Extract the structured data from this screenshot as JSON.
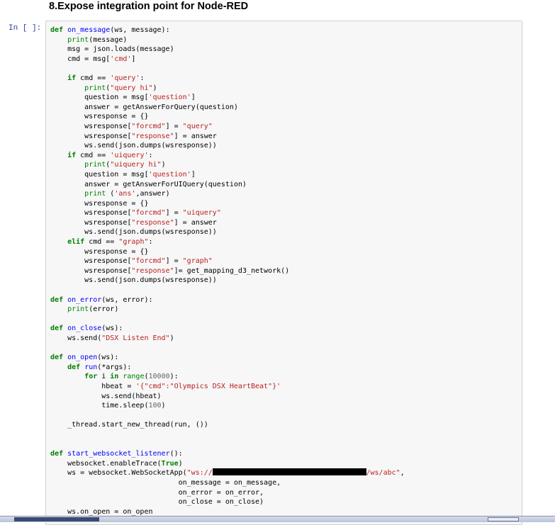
{
  "heading": "8.Expose integration point for Node-RED",
  "cell": {
    "prompt": "In [ ]:",
    "lines": [
      [
        [
          "kw",
          "def "
        ],
        [
          "fn",
          "on_message"
        ],
        [
          "t",
          "(ws, message):"
        ]
      ],
      [
        [
          "t",
          "    "
        ],
        [
          "bi",
          "print"
        ],
        [
          "t",
          "(message)"
        ]
      ],
      [
        [
          "t",
          "    msg = json.loads(message)"
        ]
      ],
      [
        [
          "t",
          "    cmd = msg["
        ],
        [
          "str",
          "'cmd'"
        ],
        [
          "t",
          "]"
        ]
      ],
      [
        [
          "t",
          ""
        ]
      ],
      [
        [
          "t",
          "    "
        ],
        [
          "kw",
          "if"
        ],
        [
          "t",
          " cmd == "
        ],
        [
          "str",
          "'query'"
        ],
        [
          "t",
          ":"
        ]
      ],
      [
        [
          "t",
          "        "
        ],
        [
          "bi",
          "print"
        ],
        [
          "t",
          "("
        ],
        [
          "str",
          "\"query hi\""
        ],
        [
          "t",
          ")"
        ]
      ],
      [
        [
          "t",
          "        question = msg["
        ],
        [
          "str",
          "'question'"
        ],
        [
          "t",
          "]"
        ]
      ],
      [
        [
          "t",
          "        answer = getAnswerForQuery(question)"
        ]
      ],
      [
        [
          "t",
          "        wsresponse = {}"
        ]
      ],
      [
        [
          "t",
          "        wsresponse["
        ],
        [
          "str",
          "\"forcmd\""
        ],
        [
          "t",
          "] = "
        ],
        [
          "str",
          "\"query\""
        ]
      ],
      [
        [
          "t",
          "        wsresponse["
        ],
        [
          "str",
          "\"response\""
        ],
        [
          "t",
          "] = answer"
        ]
      ],
      [
        [
          "t",
          "        ws.send(json.dumps(wsresponse))"
        ]
      ],
      [
        [
          "t",
          "    "
        ],
        [
          "kw",
          "if"
        ],
        [
          "t",
          " cmd == "
        ],
        [
          "str",
          "'uiquery'"
        ],
        [
          "t",
          ":"
        ]
      ],
      [
        [
          "t",
          "        "
        ],
        [
          "bi",
          "print"
        ],
        [
          "t",
          "("
        ],
        [
          "str",
          "\"uiquery hi\""
        ],
        [
          "t",
          ")"
        ]
      ],
      [
        [
          "t",
          "        question = msg["
        ],
        [
          "str",
          "'question'"
        ],
        [
          "t",
          "]"
        ]
      ],
      [
        [
          "t",
          "        answer = getAnswerForUIQuery(question)"
        ]
      ],
      [
        [
          "t",
          "        "
        ],
        [
          "bi",
          "print"
        ],
        [
          "t",
          " ("
        ],
        [
          "str",
          "'ans'"
        ],
        [
          "t",
          ",answer)"
        ]
      ],
      [
        [
          "t",
          "        wsresponse = {}"
        ]
      ],
      [
        [
          "t",
          "        wsresponse["
        ],
        [
          "str",
          "\"forcmd\""
        ],
        [
          "t",
          "] = "
        ],
        [
          "str",
          "\"uiquery\""
        ]
      ],
      [
        [
          "t",
          "        wsresponse["
        ],
        [
          "str",
          "\"response\""
        ],
        [
          "t",
          "] = answer"
        ]
      ],
      [
        [
          "t",
          "        ws.send(json.dumps(wsresponse))"
        ]
      ],
      [
        [
          "t",
          "    "
        ],
        [
          "kw",
          "elif"
        ],
        [
          "t",
          " cmd == "
        ],
        [
          "str",
          "\"graph\""
        ],
        [
          "t",
          ":"
        ]
      ],
      [
        [
          "t",
          "        wsresponse = {}"
        ]
      ],
      [
        [
          "t",
          "        wsresponse["
        ],
        [
          "str",
          "\"forcmd\""
        ],
        [
          "t",
          "] = "
        ],
        [
          "str",
          "\"graph\""
        ]
      ],
      [
        [
          "t",
          "        wsresponse["
        ],
        [
          "str",
          "\"response\""
        ],
        [
          "t",
          "]= get_mapping_d3_network()"
        ]
      ],
      [
        [
          "t",
          "        ws.send(json.dumps(wsresponse))"
        ]
      ],
      [
        [
          "t",
          ""
        ]
      ],
      [
        [
          "kw",
          "def "
        ],
        [
          "fn",
          "on_error"
        ],
        [
          "t",
          "(ws, error):"
        ]
      ],
      [
        [
          "t",
          "    "
        ],
        [
          "bi",
          "print"
        ],
        [
          "t",
          "(error)"
        ]
      ],
      [
        [
          "t",
          ""
        ]
      ],
      [
        [
          "kw",
          "def "
        ],
        [
          "fn",
          "on_close"
        ],
        [
          "t",
          "(ws):"
        ]
      ],
      [
        [
          "t",
          "    ws.send("
        ],
        [
          "str",
          "\"DSX Listen End\""
        ],
        [
          "t",
          ")"
        ]
      ],
      [
        [
          "t",
          ""
        ]
      ],
      [
        [
          "kw",
          "def "
        ],
        [
          "fn",
          "on_open"
        ],
        [
          "t",
          "(ws):"
        ]
      ],
      [
        [
          "t",
          "    "
        ],
        [
          "kw",
          "def "
        ],
        [
          "fn",
          "run"
        ],
        [
          "t",
          "(*args):"
        ]
      ],
      [
        [
          "t",
          "        "
        ],
        [
          "kw",
          "for"
        ],
        [
          "t",
          " i "
        ],
        [
          "kw",
          "in"
        ],
        [
          "t",
          " "
        ],
        [
          "bi",
          "range"
        ],
        [
          "t",
          "("
        ],
        [
          "num",
          "10000"
        ],
        [
          "t",
          "):"
        ]
      ],
      [
        [
          "t",
          "            hbeat = "
        ],
        [
          "str",
          "'{\"cmd\":\"Olympics DSX HeartBeat\"}'"
        ]
      ],
      [
        [
          "t",
          "            ws.send(hbeat)"
        ]
      ],
      [
        [
          "t",
          "            time.sleep("
        ],
        [
          "num",
          "100"
        ],
        [
          "t",
          ")"
        ]
      ],
      [
        [
          "t",
          ""
        ]
      ],
      [
        [
          "t",
          "    _thread.start_new_thread(run, ())"
        ]
      ],
      [
        [
          "t",
          ""
        ]
      ],
      [
        [
          "t",
          ""
        ]
      ],
      [
        [
          "kw",
          "def "
        ],
        [
          "fn",
          "start_websocket_listener"
        ],
        [
          "t",
          "():"
        ]
      ],
      [
        [
          "t",
          "    websocket.enableTrace("
        ],
        [
          "kw",
          "True"
        ],
        [
          "t",
          ")"
        ]
      ],
      [
        [
          "t",
          "    ws = websocket.WebSocketApp("
        ],
        [
          "str",
          "\"ws://"
        ],
        [
          "redact",
          "36"
        ],
        [
          "str",
          "/ws/abc\""
        ],
        [
          "t",
          ","
        ]
      ],
      [
        [
          "t",
          "                              on_message = on_message,"
        ]
      ],
      [
        [
          "t",
          "                              on_error = on_error,"
        ]
      ],
      [
        [
          "t",
          "                              on_close = on_close)"
        ]
      ],
      [
        [
          "t",
          "    ws.on_open = on_open"
        ]
      ]
    ]
  },
  "colors": {
    "keyword": "#008000",
    "string": "#ba2121",
    "function": "#0000ff",
    "prompt": "#303f9f",
    "cell_bg": "#f7f7f7"
  }
}
